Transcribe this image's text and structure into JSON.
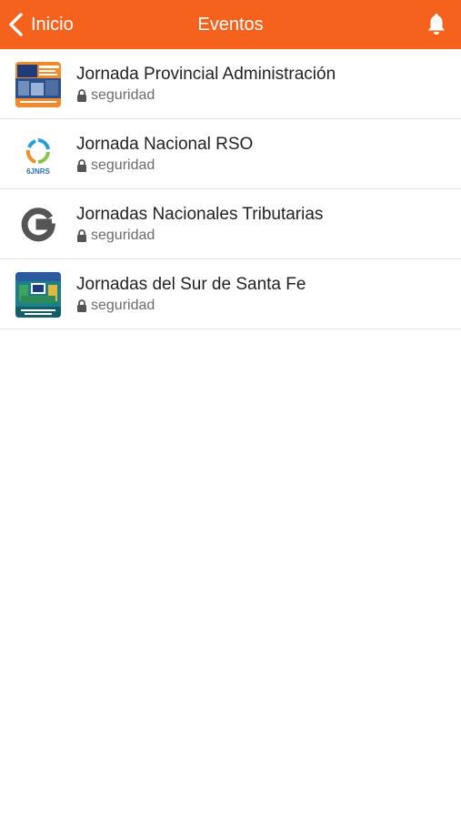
{
  "header": {
    "back_label": "Inicio",
    "title": "Eventos",
    "back_icon": "chevron-left-icon",
    "bell_icon": "bell-icon",
    "background_color": "#f5621d"
  },
  "events": [
    {
      "name": "Jornada Provincial Administración",
      "meta": "seguridad",
      "thumb_icon": "event-banner-thumbnail"
    },
    {
      "name": "Jornada Nacional RSO",
      "meta": "seguridad",
      "thumb_icon": "6jnrs-logo"
    },
    {
      "name": "Jornadas Nacionales Tributarias",
      "meta": "seguridad",
      "thumb_icon": "g-logo"
    },
    {
      "name": "Jornadas del Sur de Santa Fe",
      "meta": "seguridad",
      "thumb_icon": "event-poster-thumbnail"
    }
  ]
}
